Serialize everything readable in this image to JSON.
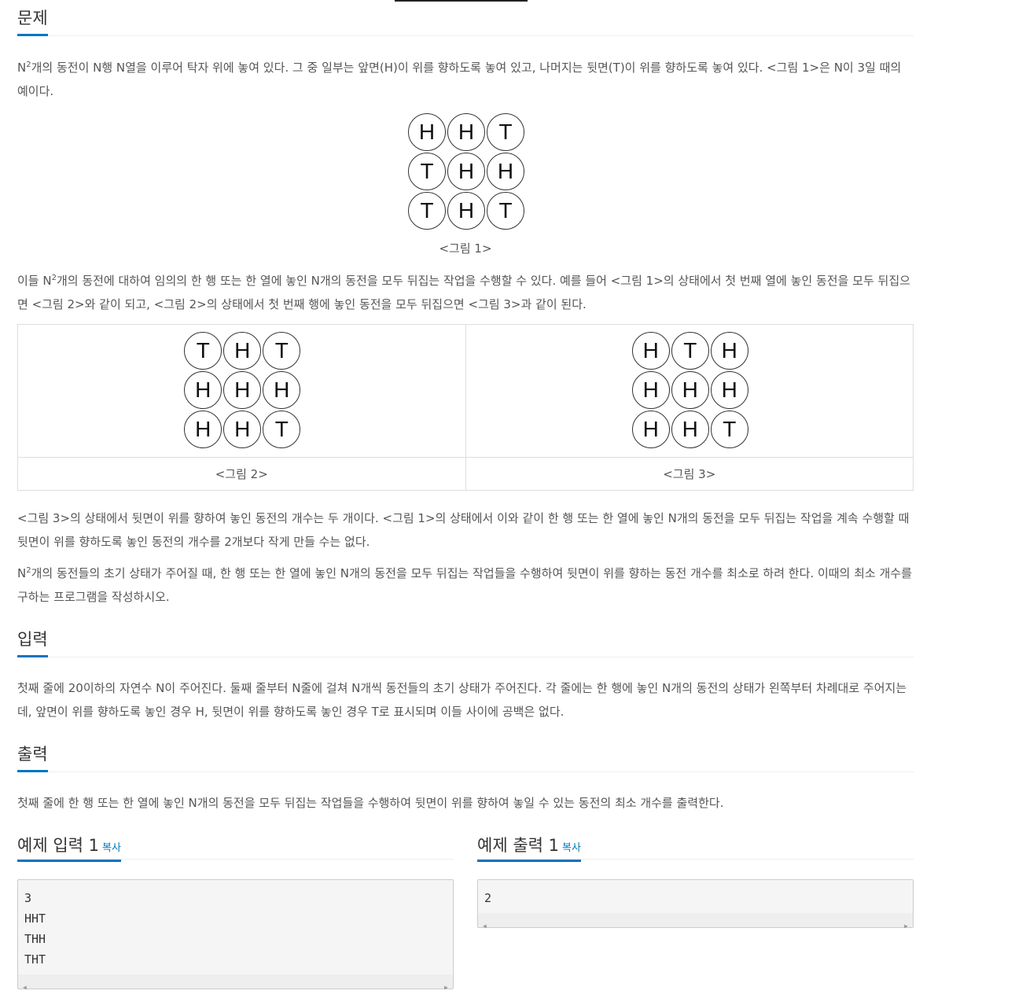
{
  "sections": {
    "problem": {
      "title": "문제",
      "p1_pre": "N",
      "p1_sup": "2",
      "p1_post": "개의 동전이 N행 N열을 이루어 탁자 위에 놓여 있다. 그 중 일부는 앞면(H)이 위를 향하도록 놓여 있고, 나머지는 뒷면(T)이 위를 향하도록 놓여 있다. <그림 1>은 N이 3일 때의 예이다.",
      "fig1": {
        "caption": "<그림 1>",
        "grid": [
          [
            "H",
            "H",
            "T"
          ],
          [
            "T",
            "H",
            "H"
          ],
          [
            "T",
            "H",
            "T"
          ]
        ]
      },
      "p2_pre": "이들 N",
      "p2_sup": "2",
      "p2_post": "개의 동전에 대하여 임의의 한 행 또는 한 열에 놓인 N개의 동전을 모두 뒤집는 작업을 수행할 수 있다. 예를 들어 <그림 1>의 상태에서 첫 번째 열에 놓인 동전을 모두 뒤집으면 <그림 2>와 같이 되고, <그림 2>의 상태에서 첫 번째 행에 놓인 동전을 모두 뒤집으면 <그림 3>과 같이 된다.",
      "fig2": {
        "caption": "<그림 2>",
        "grid": [
          [
            "T",
            "H",
            "T"
          ],
          [
            "H",
            "H",
            "H"
          ],
          [
            "H",
            "H",
            "T"
          ]
        ]
      },
      "fig3": {
        "caption": "<그림 3>",
        "grid": [
          [
            "H",
            "T",
            "H"
          ],
          [
            "H",
            "H",
            "H"
          ],
          [
            "H",
            "H",
            "T"
          ]
        ]
      },
      "p3": "<그림 3>의 상태에서 뒷면이 위를 향하여 놓인 동전의 개수는 두 개이다. <그림 1>의 상태에서 이와 같이 한 행 또는 한 열에 놓인 N개의 동전을 모두 뒤집는 작업을 계속 수행할 때 뒷면이 위를 향하도록 놓인 동전의 개수를 2개보다 작게 만들 수는 없다.",
      "p4_pre": "N",
      "p4_sup": "2",
      "p4_post": "개의 동전들의 초기 상태가 주어질 때, 한 행 또는 한 열에 놓인 N개의 동전을 모두 뒤집는 작업들을 수행하여 뒷면이 위를 향하는 동전 개수를 최소로 하려 한다. 이때의 최소 개수를 구하는 프로그램을 작성하시오."
    },
    "input": {
      "title": "입력",
      "text": "첫째 줄에 20이하의 자연수 N이 주어진다. 둘째 줄부터 N줄에 걸쳐 N개씩 동전들의 초기 상태가 주어진다. 각 줄에는 한 행에 놓인 N개의 동전의 상태가 왼쪽부터 차례대로 주어지는데, 앞면이 위를 향하도록 놓인 경우 H, 뒷면이 위를 향하도록 놓인 경우 T로 표시되며 이들 사이에 공백은 없다."
    },
    "output": {
      "title": "출력",
      "text": "첫째 줄에 한 행 또는 한 열에 놓인 N개의 동전을 모두 뒤집는 작업들을 수행하여 뒷면이 위를 향하여 놓일 수 있는 동전의 최소 개수를 출력한다."
    }
  },
  "samples": {
    "input": {
      "title": "예제 입력 1",
      "copy": "복사",
      "content": "3\nHHT\nTHH\nTHT"
    },
    "output": {
      "title": "예제 출력 1",
      "copy": "복사",
      "content": "2"
    }
  },
  "colors": {
    "accent": "#0076c0",
    "text": "#555555"
  }
}
